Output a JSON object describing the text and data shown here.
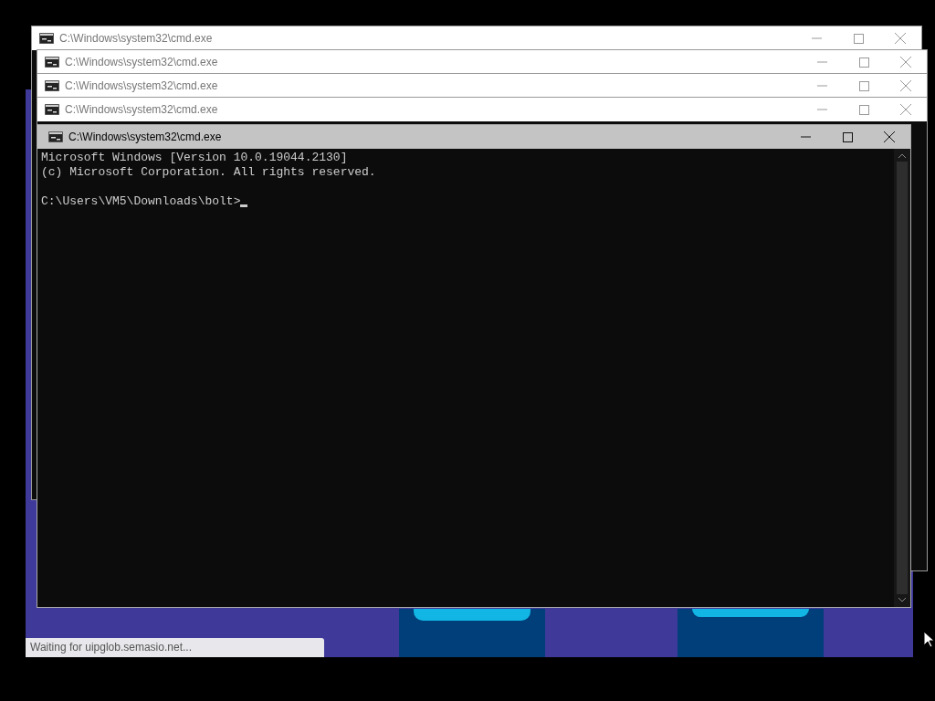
{
  "background_windows": [
    {
      "title": "C:\\Windows\\system32\\cmd.exe"
    },
    {
      "title": "C:\\Windows\\system32\\cmd.exe"
    },
    {
      "title": "C:\\Windows\\system32\\cmd.exe"
    },
    {
      "title": "C:\\Windows\\system32\\cmd.exe"
    }
  ],
  "active_window": {
    "title": "C:\\Windows\\system32\\cmd.exe",
    "banner_lines": [
      "Microsoft Windows [Version 10.0.19044.2130]",
      "(c) Microsoft Corporation. All rights reserved."
    ],
    "prompt": "C:\\Users\\VM5\\Downloads\\bolt>"
  },
  "browser": {
    "status_bar": "Waiting for uipglob.semasio.net..."
  }
}
